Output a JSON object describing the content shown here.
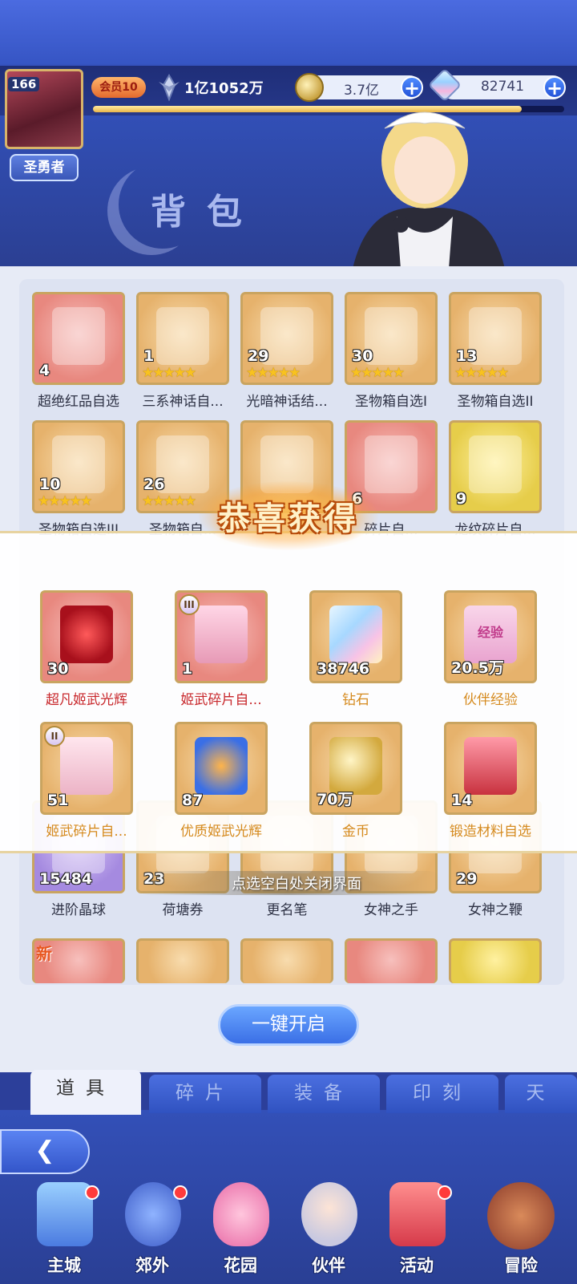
{
  "header": {
    "level": "166",
    "player_title": "圣勇者",
    "vip": "会员10",
    "power": "1亿1052万",
    "gold": "3.7亿",
    "gems": "82741",
    "xp_fraction": 0.91
  },
  "page_title": "背包",
  "bag_items": [
    {
      "qty": "4",
      "name": "超绝红品自选",
      "stars": "",
      "bg": "red"
    },
    {
      "qty": "1",
      "name": "三系神话自...",
      "stars": "★★★★★",
      "bg": "orange"
    },
    {
      "qty": "29",
      "name": "光暗神话结...",
      "stars": "★★★★★",
      "bg": "orange"
    },
    {
      "qty": "30",
      "name": "圣物箱自选I",
      "stars": "★★★★★",
      "bg": "orange"
    },
    {
      "qty": "13",
      "name": "圣物箱自选II",
      "stars": "★★★★★",
      "bg": "orange"
    },
    {
      "qty": "10",
      "name": "圣物箱自选III",
      "stars": "★★★★★",
      "bg": "orange"
    },
    {
      "qty": "26",
      "name": "圣物箱自...",
      "stars": "★★★★★",
      "bg": "orange"
    },
    {
      "qty": "",
      "name": "",
      "stars": "",
      "bg": "orange"
    },
    {
      "qty": "6",
      "name": "碎片自...",
      "stars": "",
      "bg": "red"
    },
    {
      "qty": "9",
      "name": "龙纹碎片自...",
      "stars": "",
      "bg": "yellow"
    }
  ],
  "bag_items_bottom": [
    {
      "qty": "15484",
      "name": "进阶晶球",
      "bg": "purple"
    },
    {
      "qty": "23",
      "name": "荷塘券",
      "bg": "orange"
    },
    {
      "qty": "",
      "name": "更名笔",
      "bg": "orange"
    },
    {
      "qty": "",
      "name": "女神之手",
      "bg": "orange"
    },
    {
      "qty": "29",
      "name": "女神之鞭",
      "bg": "orange"
    }
  ],
  "new_badge": "新",
  "close_hint": "点选空白处关闭界面",
  "open_all_button": "一键开启",
  "tabs": [
    "道具",
    "碎片",
    "装备",
    "印刻",
    "天"
  ],
  "nav": [
    "主城",
    "郊外",
    "花园",
    "伙伴",
    "活动",
    "冒险"
  ],
  "reward_modal": {
    "title": "恭喜获得",
    "rewards": [
      {
        "qty": "30",
        "name": "超凡姬武光辉",
        "name_color": "#c8282c",
        "bg": "red",
        "icon": "red-gem-icon",
        "roman": ""
      },
      {
        "qty": "1",
        "name": "姬武碎片自...",
        "name_color": "#c8282c",
        "bg": "red",
        "icon": "chest-iii-icon",
        "roman": "III"
      },
      {
        "qty": "38746",
        "name": "钻石",
        "name_color": "#d58a1e",
        "bg": "orange",
        "icon": "diamond-icon",
        "roman": ""
      },
      {
        "qty": "20.5万",
        "name": "伙伴经验",
        "name_color": "#d58a1e",
        "bg": "orange",
        "icon": "exp-heart-icon",
        "roman": "",
        "art_text": "经验"
      },
      {
        "qty": "51",
        "name": "姬武碎片自...",
        "name_color": "#d58a1e",
        "bg": "orange",
        "icon": "chest-ii-icon",
        "roman": "II"
      },
      {
        "qty": "87",
        "name": "优质姬武光辉",
        "name_color": "#d58a1e",
        "bg": "orange",
        "icon": "orange-gem-icon",
        "roman": ""
      },
      {
        "qty": "70万",
        "name": "金币",
        "name_color": "#d58a1e",
        "bg": "orange",
        "icon": "gold-coin-icon",
        "roman": ""
      },
      {
        "qty": "14",
        "name": "锻造材料自选",
        "name_color": "#d58a1e",
        "bg": "orange",
        "icon": "forge-chest-icon",
        "roman": ""
      }
    ]
  }
}
